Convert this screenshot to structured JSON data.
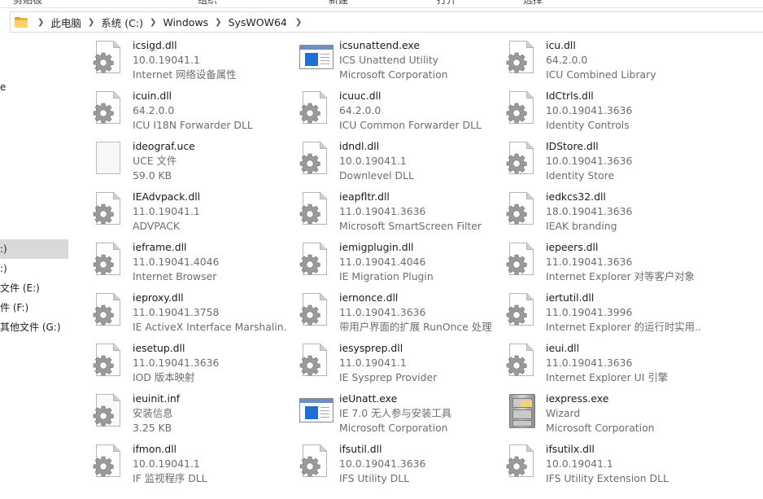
{
  "ribbon": [
    "剪贴板",
    "组织",
    "新建",
    "打开",
    "选择"
  ],
  "breadcrumb": [
    "此电脑",
    "系统 (C:)",
    "Windows",
    "SysWOW64"
  ],
  "nav": [
    {
      "label": "e",
      "selected": false
    },
    {
      "label": ":)",
      "selected": true
    },
    {
      "label": ":)",
      "selected": false
    },
    {
      "label": "文件 (E:)",
      "selected": false
    },
    {
      "label": "件 (F:)",
      "selected": false
    },
    {
      "label": "其他文件 (G:)",
      "selected": false
    }
  ],
  "files": [
    {
      "name": "icsigd.dll",
      "line2": "10.0.19041.1",
      "line3": "Internet 网络设备属性",
      "icon": "dll-gear-icon"
    },
    {
      "name": "icsunattend.exe",
      "line2": "ICS Unattend Utility",
      "line3": "Microsoft Corporation",
      "icon": "exe-window-icon"
    },
    {
      "name": "icu.dll",
      "line2": "64.2.0.0",
      "line3": "ICU Combined Library",
      "icon": "dll-gear-icon"
    },
    {
      "name": "icuin.dll",
      "line2": "64.2.0.0",
      "line3": "ICU I18N Forwarder DLL",
      "icon": "dll-gear-icon"
    },
    {
      "name": "icuuc.dll",
      "line2": "64.2.0.0",
      "line3": "ICU Common Forwarder DLL",
      "icon": "dll-gear-icon"
    },
    {
      "name": "IdCtrls.dll",
      "line2": "10.0.19041.3636",
      "line3": "Identity Controls",
      "icon": "dll-gear-icon"
    },
    {
      "name": "ideograf.uce",
      "line2": "UCE 文件",
      "line3": "59.0 KB",
      "icon": "blank-file-icon"
    },
    {
      "name": "idndl.dll",
      "line2": "10.0.19041.1",
      "line3": "Downlevel DLL",
      "icon": "dll-gear-icon"
    },
    {
      "name": "IDStore.dll",
      "line2": "10.0.19041.3636",
      "line3": "Identity Store",
      "icon": "dll-gear-icon"
    },
    {
      "name": "IEAdvpack.dll",
      "line2": "11.0.19041.1",
      "line3": "ADVPACK",
      "icon": "dll-gear-icon"
    },
    {
      "name": "ieapfltr.dll",
      "line2": "11.0.19041.3636",
      "line3": "Microsoft SmartScreen Filter",
      "icon": "dll-gear-icon"
    },
    {
      "name": "iedkcs32.dll",
      "line2": "18.0.19041.3636",
      "line3": "IEAK branding",
      "icon": "dll-gear-icon"
    },
    {
      "name": "ieframe.dll",
      "line2": "11.0.19041.4046",
      "line3": "Internet Browser",
      "icon": "dll-gear-icon"
    },
    {
      "name": "iemigplugin.dll",
      "line2": "11.0.19041.4046",
      "line3": "IE Migration Plugin",
      "icon": "dll-gear-icon"
    },
    {
      "name": "iepeers.dll",
      "line2": "11.0.19041.3636",
      "line3": "Internet Explorer 对等客户对象",
      "icon": "dll-gear-icon"
    },
    {
      "name": "ieproxy.dll",
      "line2": "11.0.19041.3758",
      "line3": "IE ActiveX Interface Marshalin...",
      "icon": "dll-gear-icon"
    },
    {
      "name": "iernonce.dll",
      "line2": "11.0.19041.3636",
      "line3": "带用户界面的扩展 RunOnce 处理",
      "icon": "dll-gear-icon"
    },
    {
      "name": "iertutil.dll",
      "line2": "11.0.19041.3996",
      "line3": "Internet Explorer 的运行时实用...",
      "icon": "dll-gear-icon"
    },
    {
      "name": "iesetup.dll",
      "line2": "11.0.19041.3636",
      "line3": "IOD 版本映射",
      "icon": "dll-gear-icon"
    },
    {
      "name": "iesysprep.dll",
      "line2": "11.0.19041.1",
      "line3": "IE Sysprep Provider",
      "icon": "dll-gear-icon"
    },
    {
      "name": "ieui.dll",
      "line2": "11.0.19041.3636",
      "line3": "Internet Explorer UI 引擎",
      "icon": "dll-gear-icon"
    },
    {
      "name": "ieuinit.inf",
      "line2": "安装信息",
      "line3": "3.25 KB",
      "icon": "inf-gear-icon"
    },
    {
      "name": "ieUnatt.exe",
      "line2": "IE 7.0 无人参与安装工具",
      "line3": "Microsoft Corporation",
      "icon": "exe-window-icon"
    },
    {
      "name": "iexpress.exe",
      "line2": "Wizard",
      "line3": "Microsoft Corporation",
      "icon": "cabinet-icon"
    },
    {
      "name": "ifmon.dll",
      "line2": "10.0.19041.1",
      "line3": "IF 监视程序 DLL",
      "icon": "dll-gear-icon"
    },
    {
      "name": "ifsutil.dll",
      "line2": "10.0.19041.3636",
      "line3": "IFS Utility DLL",
      "icon": "dll-gear-icon"
    },
    {
      "name": "ifsutilx.dll",
      "line2": "10.0.19041.1",
      "line3": "IFS Utility Extension DLL",
      "icon": "dll-gear-icon"
    }
  ]
}
